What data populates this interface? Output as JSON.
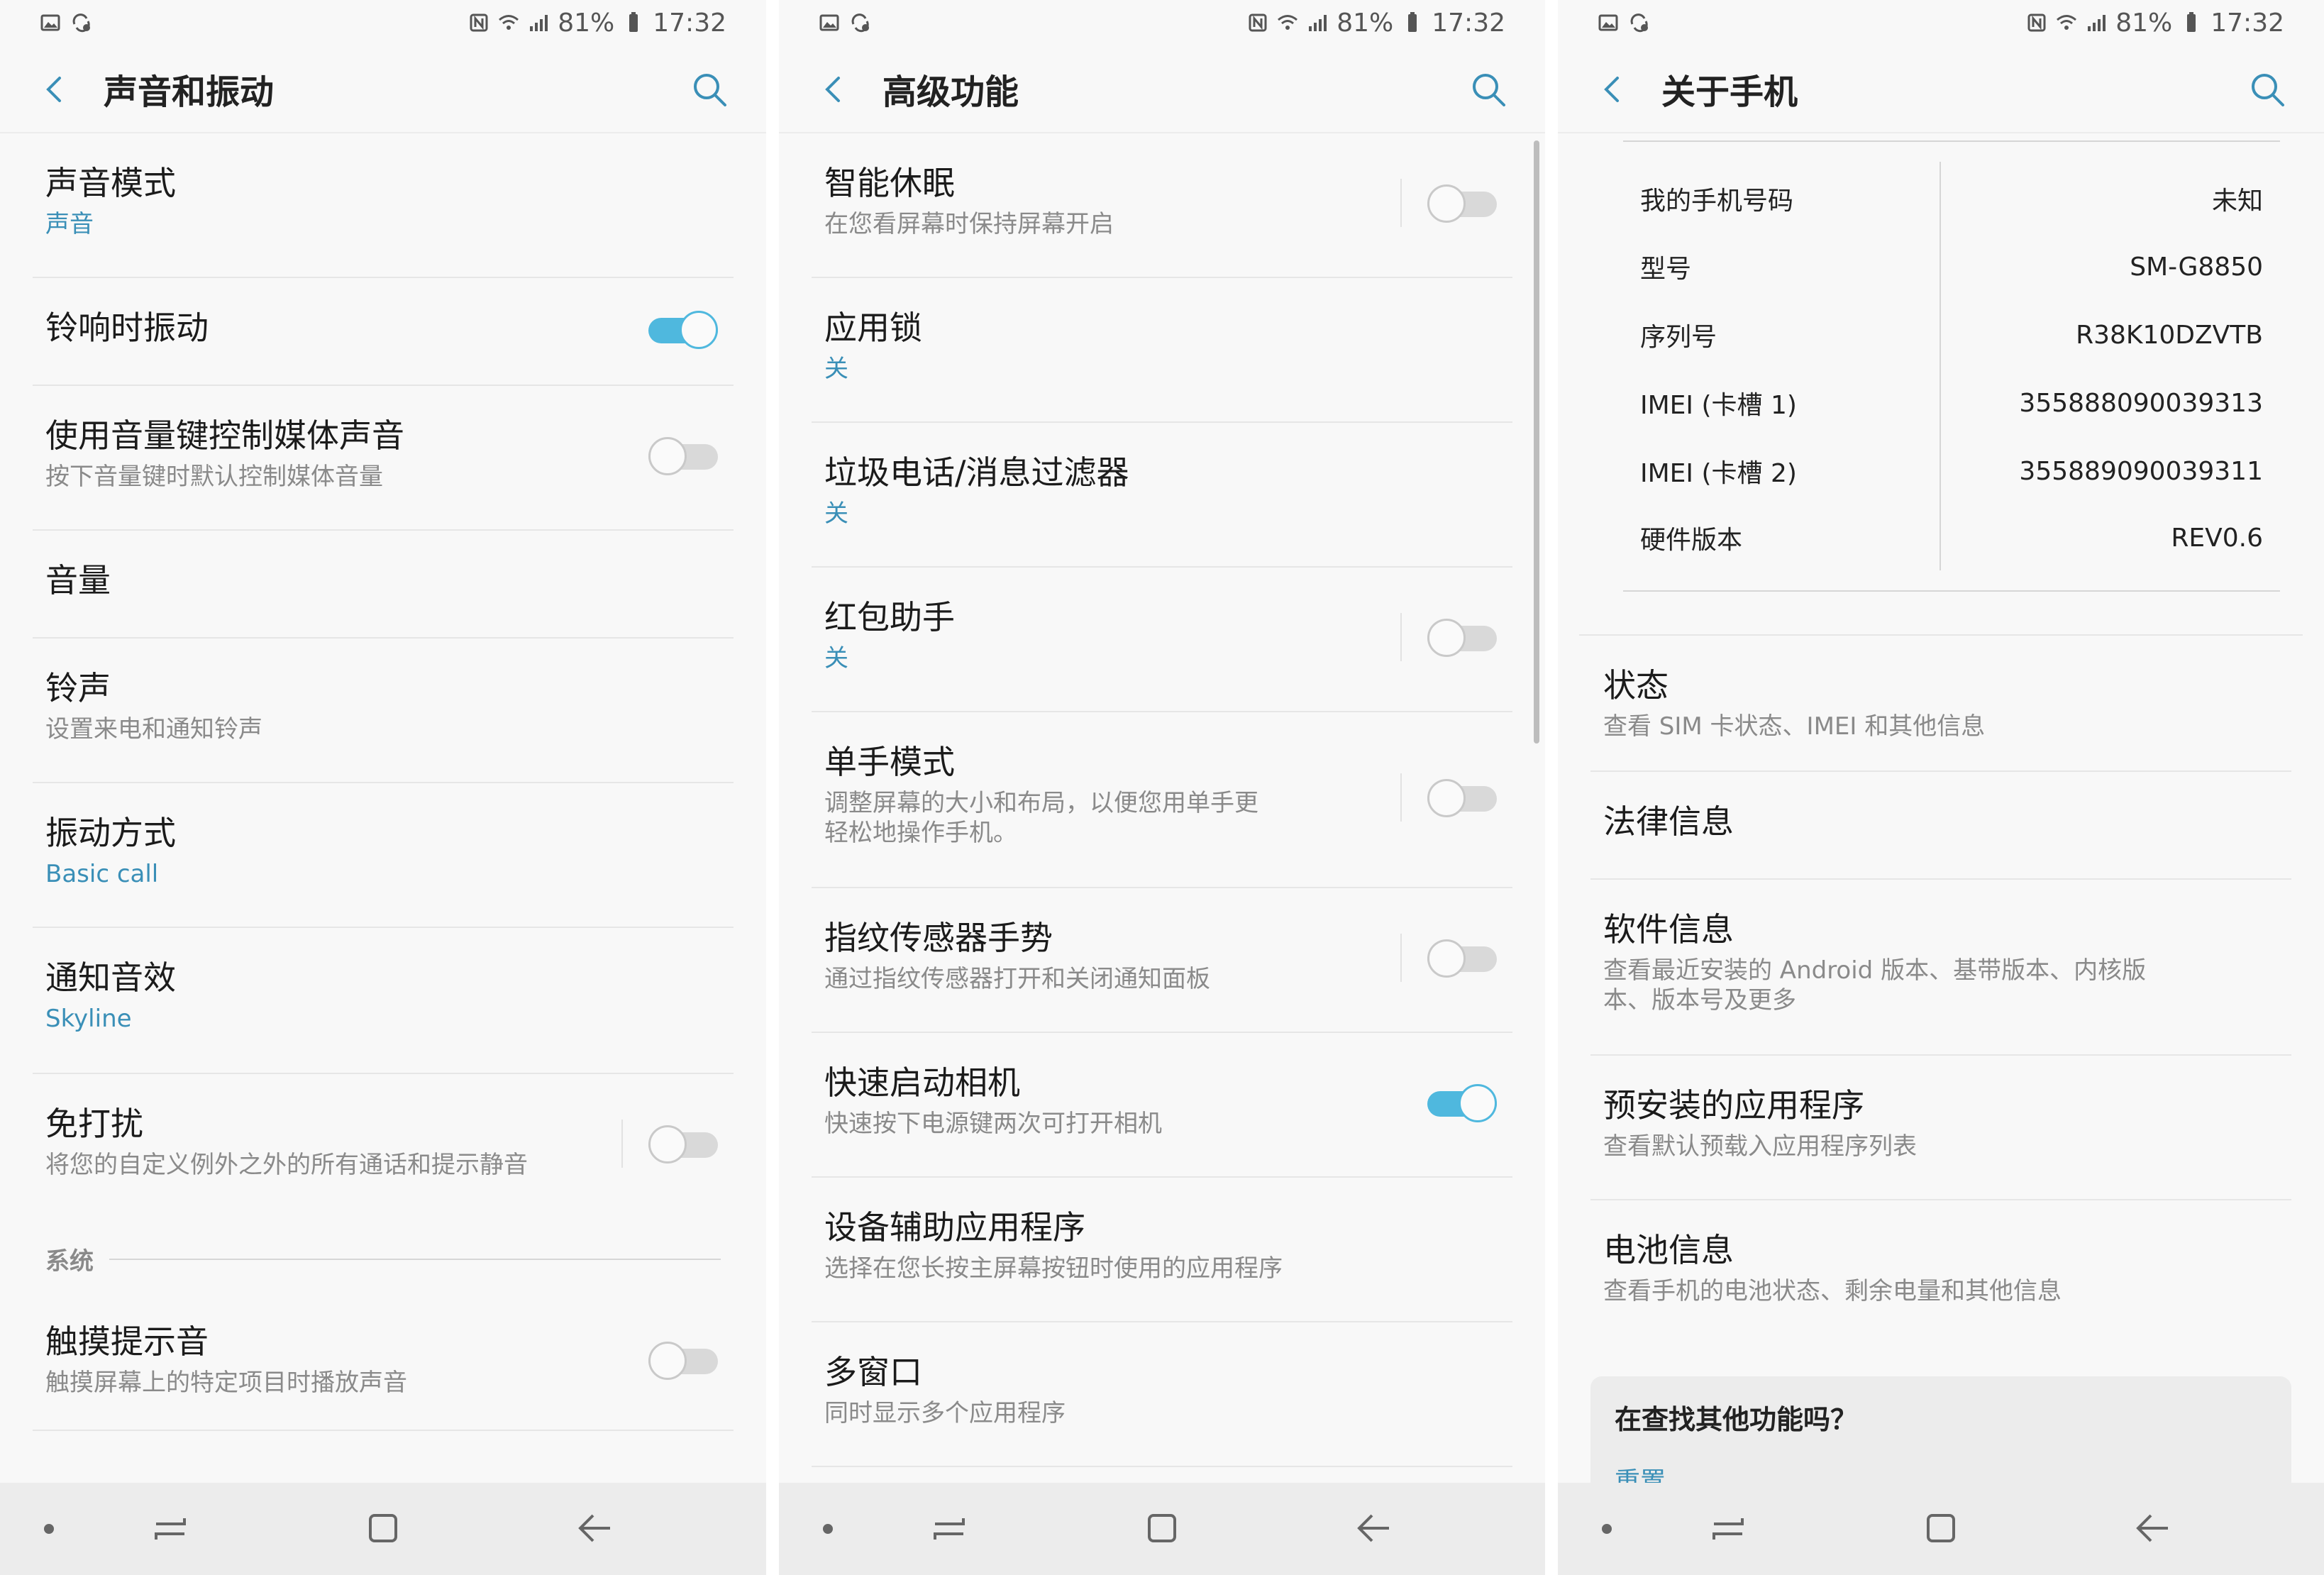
{
  "status_bar": {
    "battery_percent": "81%",
    "time": "17:32"
  },
  "panels": [
    {
      "title": "声音和振动",
      "rows": [
        {
          "title": "声音模式",
          "subtitle": "声音"
        },
        {
          "title": "铃响时振动",
          "toggle": "on"
        },
        {
          "title": "使用音量键控制媒体声音",
          "subtitle": "按下音量键时默认控制媒体音量",
          "toggle": "off"
        },
        {
          "title": "音量"
        },
        {
          "title": "铃声",
          "subtitle": "设置来电和通知铃声"
        },
        {
          "title": "振动方式",
          "subtitle": "Basic call"
        },
        {
          "title": "通知音效",
          "subtitle": "Skyline"
        },
        {
          "title": "免打扰",
          "subtitle": "将您的自定义例外之外的所有通话和提示静音",
          "toggle": "off"
        }
      ],
      "section_label": "系统",
      "section_rows": [
        {
          "title": "触摸提示音",
          "subtitle": "触摸屏幕上的特定项目时播放声音",
          "toggle": "off"
        }
      ]
    },
    {
      "title": "高级功能",
      "rows": [
        {
          "title": "智能休眠",
          "subtitle": "在您看屏幕时保持屏幕开启",
          "toggle": "off"
        },
        {
          "title": "应用锁",
          "subtitle": "关"
        },
        {
          "title": "垃圾电话/消息过滤器",
          "subtitle": "关"
        },
        {
          "title": "红包助手",
          "subtitle": "关",
          "toggle": "off"
        },
        {
          "title": "单手模式",
          "subtitle_line1": "调整屏幕的大小和布局，以便您用单手更",
          "subtitle_line2": "轻松地操作手机。",
          "toggle": "off"
        },
        {
          "title": "指纹传感器手势",
          "subtitle": "通过指纹传感器打开和关闭通知面板",
          "toggle": "off"
        },
        {
          "title": "快速启动相机",
          "subtitle": "快速按下电源键两次可打开相机",
          "toggle": "on"
        },
        {
          "title": "设备辅助应用程序",
          "subtitle": "选择在您长按主屏幕按钮时使用的应用程序"
        },
        {
          "title": "多窗口",
          "subtitle": "同时显示多个应用程序"
        }
      ]
    },
    {
      "title": "关于手机",
      "info": [
        {
          "key": "我的手机号码",
          "value": "未知"
        },
        {
          "key": "型号",
          "value": "SM-G8850"
        },
        {
          "key": "序列号",
          "value": "R38K10DZVTB"
        },
        {
          "key": "IMEI (卡槽 1)",
          "value": "355888090039313"
        },
        {
          "key": "IMEI (卡槽 2)",
          "value": "355889090039311"
        },
        {
          "key": "硬件版本",
          "value": "REV0.6"
        }
      ],
      "rows": [
        {
          "title": "状态",
          "subtitle": "查看 SIM 卡状态、IMEI 和其他信息"
        },
        {
          "title": "法律信息"
        },
        {
          "title": "软件信息",
          "subtitle_line1": "查看最近安装的 Android 版本、基带版本、内核版",
          "subtitle_line2": "本、版本号及更多"
        },
        {
          "title": "预安装的应用程序",
          "subtitle": "查看默认预载入应用程序列表"
        },
        {
          "title": "电池信息",
          "subtitle": "查看手机的电池状态、剩余电量和其他信息"
        }
      ],
      "looking_for": {
        "title": "在查找其他功能吗？",
        "link": "重置"
      }
    }
  ]
}
